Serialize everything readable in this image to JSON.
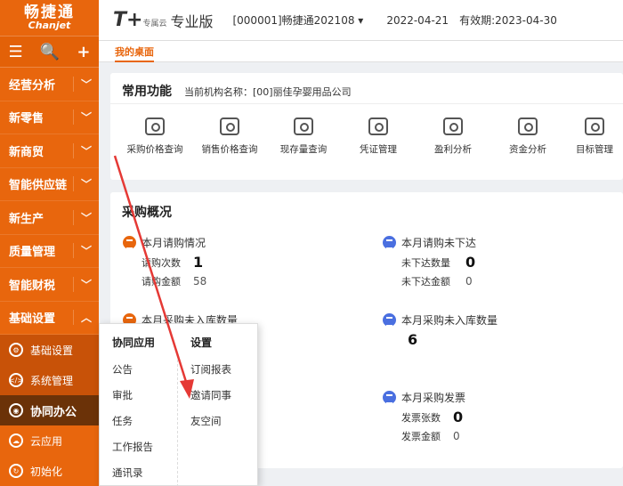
{
  "sidebar": {
    "logo_cn": "畅捷通",
    "logo_en": "Chanjet",
    "tools": [
      "☰",
      "🔍",
      "+"
    ],
    "items": [
      {
        "label": "经营分析",
        "chev": "﹀"
      },
      {
        "label": "新零售",
        "chev": "﹀"
      },
      {
        "label": "新商贸",
        "chev": "﹀"
      },
      {
        "label": "智能供应链",
        "chev": "﹀"
      },
      {
        "label": "新生产",
        "chev": "﹀"
      },
      {
        "label": "质量管理",
        "chev": "﹀"
      },
      {
        "label": "智能财税",
        "chev": "﹀"
      },
      {
        "label": "基础设置",
        "chev": "︿"
      }
    ],
    "sub_items": [
      {
        "label": "基础设置",
        "icon": "⚙"
      },
      {
        "label": "系统管理",
        "icon": "</>"
      },
      {
        "label": "协同办公",
        "icon": "◉"
      },
      {
        "label": "云应用",
        "icon": "☁"
      },
      {
        "label": "初始化",
        "icon": "↻"
      }
    ]
  },
  "topbar": {
    "brand": "T+",
    "brand_small": "专属云",
    "edition": "专业版",
    "account": "[000001]畅捷通202108 ▾",
    "date": "2022-04-21",
    "validity": "有效期:2023-04-30"
  },
  "tabs": {
    "desk": "我的桌面"
  },
  "common": {
    "title": "常用功能",
    "org": "当前机构名称：[00]丽佳孕婴用品公司",
    "functions": [
      {
        "label": "采购价格查询"
      },
      {
        "label": "销售价格查询"
      },
      {
        "label": "现存量查询"
      },
      {
        "label": "凭证管理"
      },
      {
        "label": "盈利分析"
      },
      {
        "label": "资金分析"
      },
      {
        "label": "目标管理"
      }
    ]
  },
  "overview": {
    "title": "采购概况",
    "stats": [
      {
        "title": "本月请购情况",
        "rows": [
          {
            "label": "请购次数",
            "value": "1"
          },
          {
            "label": "请购金额",
            "value": "58"
          }
        ]
      },
      {
        "title": "本月请购未下达",
        "rows": [
          {
            "label": "未下达数量",
            "value": "0"
          },
          {
            "label": "未下达金额",
            "value": "0"
          }
        ]
      },
      {
        "title": "本月采购未入库数量",
        "rows": []
      },
      {
        "title": "本月采购未入库数量",
        "rows": [
          {
            "label": "",
            "value": "6"
          }
        ]
      },
      {
        "title": "本月采购发票",
        "rows": [
          {
            "label": "发票张数",
            "value": "0"
          },
          {
            "label": "发票金额",
            "value": "0"
          }
        ]
      }
    ]
  },
  "popup": {
    "col1_head": "协同应用",
    "col1": [
      "公告",
      "审批",
      "任务",
      "工作报告",
      "通讯录"
    ],
    "col2_head": "设置",
    "col2": [
      "订阅报表",
      "邀请同事",
      "友空间"
    ]
  },
  "colors": {
    "brand_orange": "#e8660d",
    "accent_blue": "#4a6fe0",
    "annotation_red": "#e53935"
  }
}
